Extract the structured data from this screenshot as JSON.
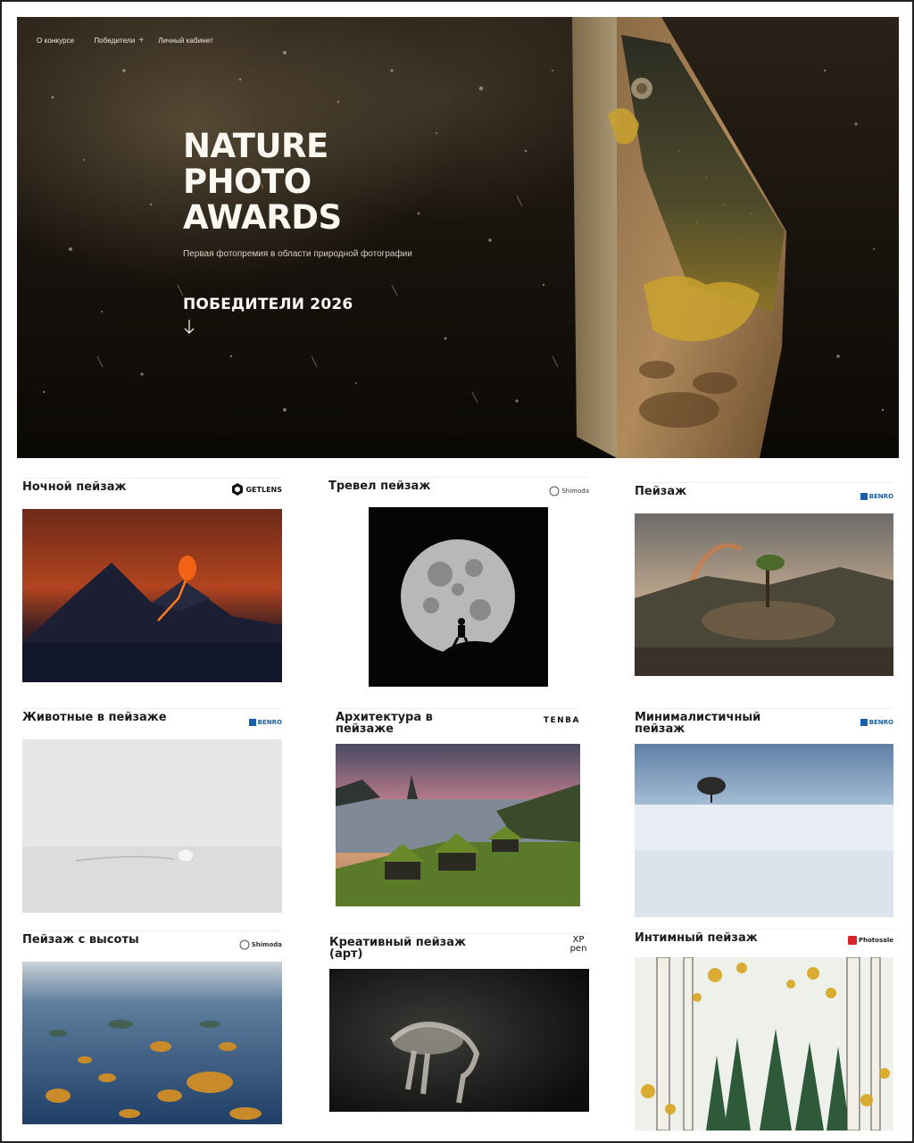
{
  "nav": {
    "items": [
      "О конкурсе",
      "Победители",
      "Личный кабинет"
    ],
    "plus": "+"
  },
  "hero": {
    "title_lines": [
      "NATURE",
      "PHOTO",
      "AWARDS"
    ],
    "subtitle": "Первая фотопремия в области природной фотографии",
    "cta": "ПОБЕДИТЕЛИ 2026",
    "arrow_icon": "arrow-down-icon"
  },
  "categories": [
    {
      "title": "Ночной пейзаж",
      "sponsor": "GETLENS",
      "photo": "volcano-night"
    },
    {
      "title": "Тревел пейзаж",
      "sponsor": "Shimoda",
      "photo": "moon-hiker"
    },
    {
      "title": "Пейзаж",
      "sponsor": "BENRO",
      "photo": "rainbow-tree-rock"
    },
    {
      "title": "Животные в пейзаже",
      "sponsor": "BENRO",
      "photo": "arctic-fox-fog"
    },
    {
      "title": "Архитектура в пейзаже",
      "sponsor": "TENBA",
      "photo": "turf-houses-fjord"
    },
    {
      "title": "Минималистичный пейзаж",
      "sponsor": "BENRO",
      "photo": "lone-tree-snow"
    },
    {
      "title": "Пейзаж с высоты",
      "sponsor": "Shimoda",
      "photo": "aerial-islands"
    },
    {
      "title": "Креативный пейзаж (арт)",
      "sponsor": "XP pen",
      "photo": "horse-motion-blur"
    },
    {
      "title": "Интимный пейзаж",
      "sponsor": "Photosale",
      "photo": "birch-forest"
    }
  ],
  "colors": {
    "hero_bg": "#17120c",
    "text_light": "#fbf8f2",
    "benro_blue": "#1a5fa8",
    "photosale_red": "#d8232a"
  }
}
